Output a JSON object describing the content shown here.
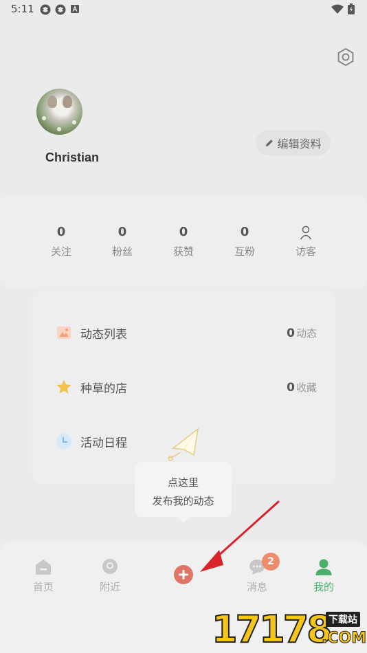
{
  "status_bar": {
    "time": "5:11",
    "icons": [
      "notification-icon",
      "notification-icon",
      "a-icon"
    ],
    "right_icons": [
      "wifi-icon",
      "battery-icon"
    ]
  },
  "profile": {
    "username": "Christian",
    "edit_label": "编辑资料"
  },
  "stats": [
    {
      "value": "0",
      "label": "关注"
    },
    {
      "value": "0",
      "label": "粉丝"
    },
    {
      "value": "0",
      "label": "获赞"
    },
    {
      "value": "0",
      "label": "互粉"
    },
    {
      "value": "",
      "label": "访客",
      "icon": "person-outline-icon"
    }
  ],
  "menu": [
    {
      "label": "动态列表",
      "count": "0",
      "unit": "动态",
      "icon": "image-icon",
      "icon_color": "#f5a27c"
    },
    {
      "label": "种草的店",
      "count": "0",
      "unit": "收藏",
      "icon": "star-icon",
      "icon_color": "#f2c24a"
    },
    {
      "label": "活动日程",
      "count": "",
      "unit": "",
      "icon": "clock-icon",
      "icon_color": "#7ab8ea"
    }
  ],
  "tooltip": {
    "line1": "点这里",
    "line2": "发布我的动态"
  },
  "tabbar": {
    "tabs": [
      {
        "label": "首页",
        "icon": "home-icon"
      },
      {
        "label": "附近",
        "icon": "location-icon"
      },
      {
        "label": "",
        "icon": "plus-icon"
      },
      {
        "label": "消息",
        "icon": "chat-icon",
        "badge": "2"
      },
      {
        "label": "我的",
        "icon": "user-icon",
        "active": true
      }
    ]
  },
  "colors": {
    "accent_green": "#4cb06b",
    "publish_red": "#e07565",
    "badge_orange": "#ef8a6c",
    "arrow_red": "#d9222a"
  },
  "watermark": {
    "number": "17178",
    "tag": "下载站",
    "domain": ".COM"
  }
}
